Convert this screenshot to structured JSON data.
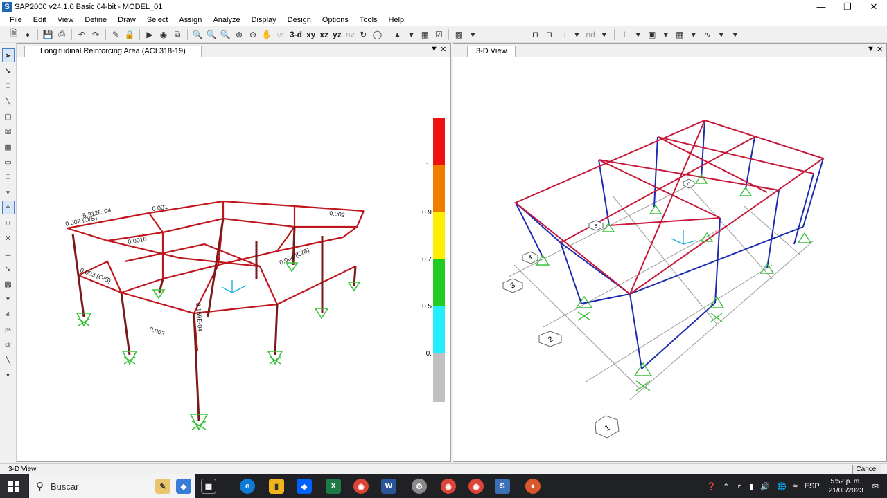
{
  "window": {
    "title": "SAP2000 v24.1.0 Basic 64-bit - MODEL_01",
    "app_icon": "S"
  },
  "menu": [
    "File",
    "Edit",
    "View",
    "Define",
    "Draw",
    "Select",
    "Assign",
    "Analyze",
    "Display",
    "Design",
    "Options",
    "Tools",
    "Help"
  ],
  "toolbar": {
    "view_3d": "3-d",
    "view_xy": "xy",
    "view_xz": "xz",
    "view_yz": "yz",
    "view_nv": "nv",
    "nd": "nd"
  },
  "left_panel": {
    "tab": "Longitudinal Reinforcing Area  (ACI 318-19)",
    "scale_labels": [
      "1.",
      "0.9",
      "0.7",
      "0.5",
      "0."
    ],
    "scale_colors": [
      "#ee1111",
      "#f07c00",
      "#ffee00",
      "#22cc22",
      "#22eeff",
      "#c0c0c0"
    ],
    "member_labels": [
      "0.002 (O/S)",
      "0.001",
      "0.003 (O/S)",
      "0.0016",
      "5.312E-04",
      "8.159E-04",
      "0.004 (O/S)",
      "0.003",
      "0.002"
    ]
  },
  "right_panel": {
    "tab": "3-D View",
    "grid_bubbles": [
      "1",
      "2",
      "3",
      "A",
      "B",
      "C"
    ]
  },
  "status": {
    "left": "3-D View",
    "cancel": "Cancel"
  },
  "taskbar": {
    "search": "Buscar",
    "lang": "ESP",
    "time": "5:52 p. m.",
    "date": "21/03/2023"
  }
}
